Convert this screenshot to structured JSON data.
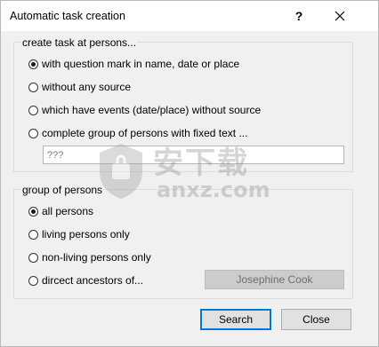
{
  "window": {
    "title": "Automatic task creation",
    "help_label": "?"
  },
  "task_group": {
    "title": "create task at persons...",
    "options": [
      {
        "label": "with question mark in name, date or place",
        "checked": true
      },
      {
        "label": "without any source",
        "checked": false
      },
      {
        "label": "which have events (date/place) without source",
        "checked": false
      },
      {
        "label": "complete group of persons with fixed text ...",
        "checked": false
      }
    ],
    "fixed_text_value": "???"
  },
  "persons_group": {
    "title": "group of persons",
    "options": [
      {
        "label": "all persons",
        "checked": true
      },
      {
        "label": "living persons only",
        "checked": false
      },
      {
        "label": "non-living persons only",
        "checked": false
      },
      {
        "label": "dircect ancestors of...",
        "checked": false
      }
    ],
    "person_button_label": "Josephine Cook"
  },
  "footer": {
    "search_label": "Search",
    "close_label": "Close"
  },
  "watermark": {
    "text_cn": "安下载",
    "text_en": "anxz.com"
  },
  "colors": {
    "accent": "#0078d7",
    "dialog_bg": "#f0f0f0",
    "disabled_button_bg": "#cccccc"
  }
}
